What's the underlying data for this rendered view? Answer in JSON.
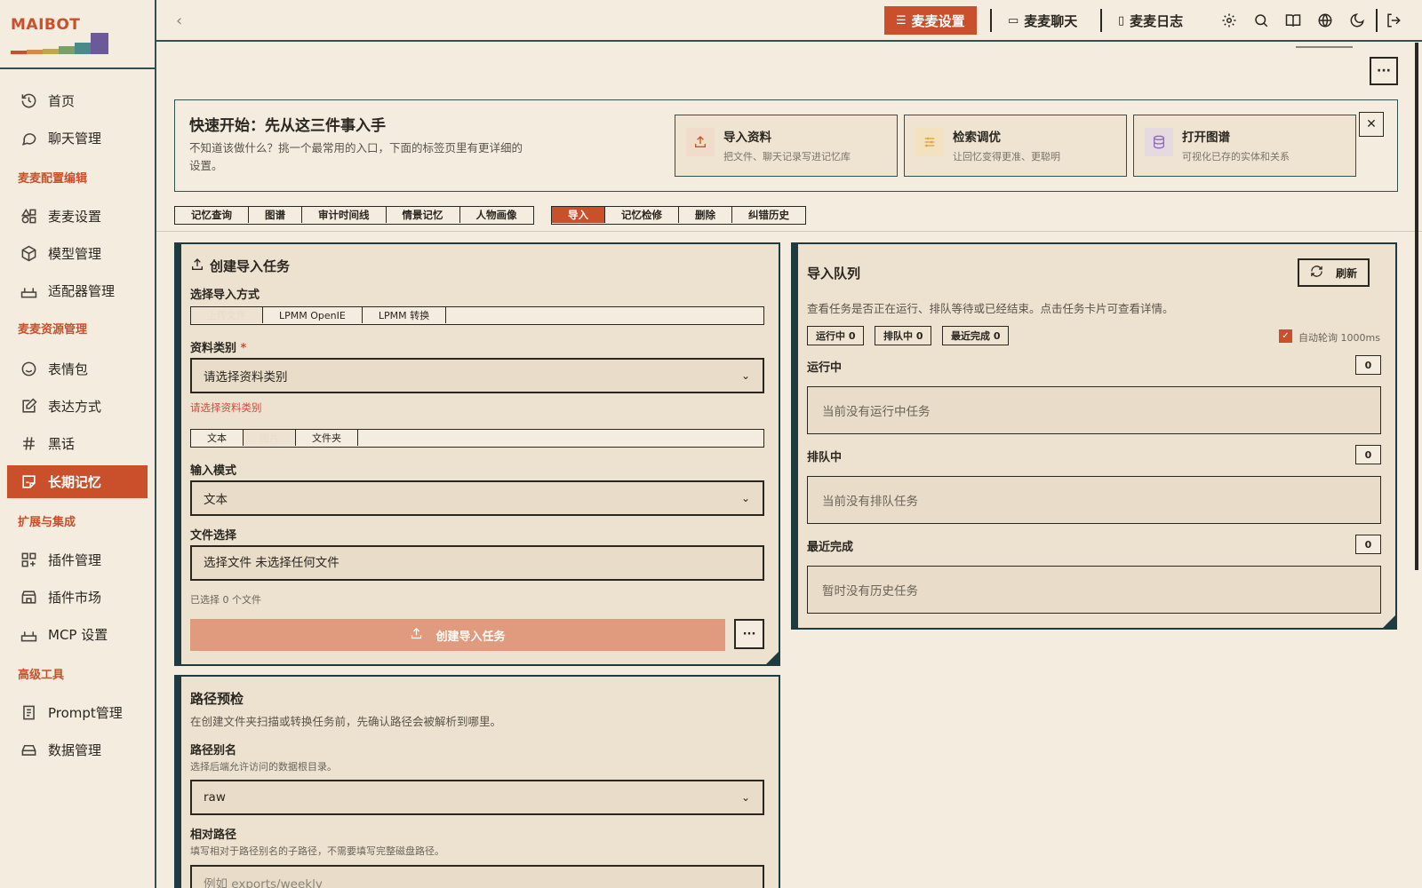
{
  "brand": {
    "name": "MAIBOT",
    "colors": {
      "accent": "#c9502a",
      "dark": "#1e3b40"
    }
  },
  "sidebar": {
    "items": [
      {
        "label": "首页",
        "icon": "home-icon"
      },
      {
        "label": "聊天管理",
        "icon": "chat-icon"
      },
      {
        "label": "麦麦设置",
        "icon": "settings-shapes-icon"
      },
      {
        "label": "模型管理",
        "icon": "box-icon"
      },
      {
        "label": "适配器管理",
        "icon": "router-icon"
      },
      {
        "label": "表情包",
        "icon": "smile-icon"
      },
      {
        "label": "表达方式",
        "icon": "edit-icon"
      },
      {
        "label": "黑话",
        "icon": "hash-icon"
      },
      {
        "label": "长期记忆",
        "icon": "sticky-note-icon"
      },
      {
        "label": "插件管理",
        "icon": "grid-plus-icon"
      },
      {
        "label": "插件市场",
        "icon": "store-icon"
      },
      {
        "label": "MCP 设置",
        "icon": "router-icon"
      },
      {
        "label": "Prompt管理",
        "icon": "document-icon"
      },
      {
        "label": "数据管理",
        "icon": "drive-icon"
      }
    ],
    "sections": [
      "麦麦配置编辑",
      "麦麦资源管理",
      "扩展与集成",
      "高级工具"
    ]
  },
  "topbar": {
    "tabs": [
      "麦麦设置",
      "麦麦聊天",
      "麦麦日志"
    ],
    "icons": [
      "gear-icon",
      "search-icon",
      "book-icon",
      "globe-icon",
      "moon-icon",
      "logout-icon"
    ]
  },
  "quickstart": {
    "title": "快速开始：先从这三件事入手",
    "desc": "不知道该做什么？挑一个最常用的入口，下面的标签页里有更详细的设置。",
    "cards": [
      {
        "title": "导入资料",
        "desc": "把文件、聊天记录写进记忆库",
        "icon": "upload-icon",
        "color": "#c9502a",
        "bg": "#f1dccb"
      },
      {
        "title": "检索调优",
        "desc": "让回忆变得更准、更聪明",
        "icon": "sliders-icon",
        "color": "#e0a030",
        "bg": "#f2e2bf"
      },
      {
        "title": "打开图谱",
        "desc": "可视化已存的实体和关系",
        "icon": "database-icon",
        "color": "#8a6ac0",
        "bg": "#e6dae0"
      }
    ]
  },
  "tabs": {
    "group1": [
      "记忆查询",
      "图谱",
      "审计时间线",
      "情景记忆",
      "人物画像"
    ],
    "group2": [
      "导入",
      "记忆检修",
      "删除",
      "纠错历史"
    ],
    "active": "导入"
  },
  "create_task": {
    "title": "创建导入任务",
    "method_label": "选择导入方式",
    "methods": [
      "上传文件",
      "LPMM OpenIE",
      "LPMM 转换"
    ],
    "category_label": "资料类别",
    "required_mark": "*",
    "category_placeholder": "请选择资料类别",
    "category_error": "请选择资料类别",
    "source_types": [
      "文本",
      "图片",
      "文件夹"
    ],
    "input_mode_label": "输入模式",
    "input_mode_value": "文本",
    "file_label": "文件选择",
    "file_button": "选择文件",
    "file_status": "未选择任何文件",
    "selected_count": "已选择 0 个文件",
    "submit": "创建导入任务",
    "more": "···"
  },
  "path_check": {
    "title": "路径预检",
    "desc": "在创建文件夹扫描或转换任务前，先确认路径会被解析到哪里。",
    "alias_label": "路径别名",
    "alias_hint": "选择后端允许访问的数据根目录。",
    "alias_value": "raw",
    "rel_label": "相对路径",
    "rel_hint": "填写相对于路径别名的子路径，不需要填写完整磁盘路径。",
    "rel_placeholder": "例如 exports/weekly"
  },
  "queue": {
    "title": "导入队列",
    "refresh": "刷新",
    "desc": "查看任务是否正在运行、排队等待或已经结束。点击任务卡片可查看详情。",
    "badges": [
      "运行中 0",
      "排队中 0",
      "最近完成 0"
    ],
    "auto_poll": "自动轮询 1000ms",
    "running_label": "运行中",
    "running_count": "0",
    "running_empty": "当前没有运行中任务",
    "queued_label": "排队中",
    "queued_count": "0",
    "queued_empty": "当前没有排队任务",
    "done_label": "最近完成",
    "done_count": "0",
    "done_empty": "暂时没有历史任务"
  }
}
